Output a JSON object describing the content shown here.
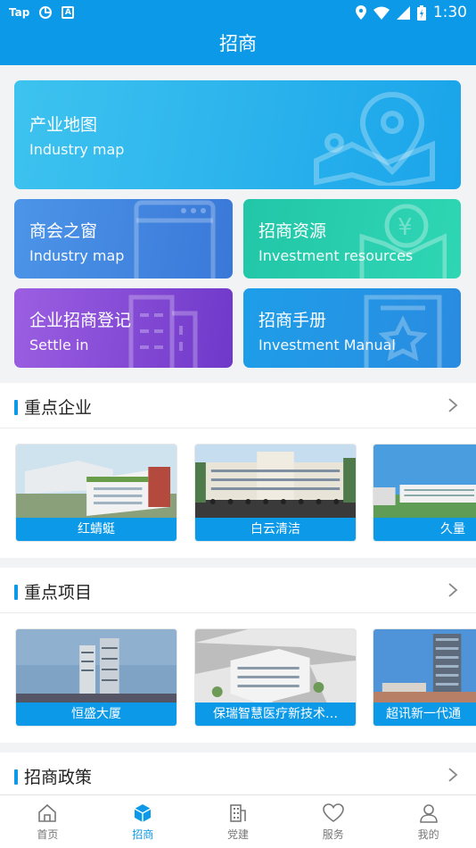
{
  "status_bar": {
    "left_text": "Tap",
    "time": "1:30"
  },
  "header": {
    "title": "招商"
  },
  "cards": [
    {
      "zh": "产业地图",
      "en": "Industry map"
    },
    {
      "zh": "商会之窗",
      "en": "Industry map"
    },
    {
      "zh": "招商资源",
      "en": "Investment resources"
    },
    {
      "zh": "企业招商登记",
      "en": "Settle in"
    },
    {
      "zh": "招商手册",
      "en": "Investment Manual"
    }
  ],
  "sections": [
    {
      "title": "重点企业",
      "items": [
        "红蜻蜓",
        "白云清洁",
        "久量"
      ]
    },
    {
      "title": "重点项目",
      "items": [
        "恒盛大厦",
        "保瑞智慧医疗新技术…",
        "超讯新一代通"
      ]
    },
    {
      "title": "招商政策"
    }
  ],
  "bottom_nav": [
    {
      "label": "首页",
      "icon": "home-icon"
    },
    {
      "label": "招商",
      "icon": "cube-icon",
      "active": true
    },
    {
      "label": "党建",
      "icon": "building-icon"
    },
    {
      "label": "服务",
      "icon": "heart-icon"
    },
    {
      "label": "我的",
      "icon": "user-icon"
    }
  ],
  "colors": {
    "primary": "#0b99e8"
  }
}
